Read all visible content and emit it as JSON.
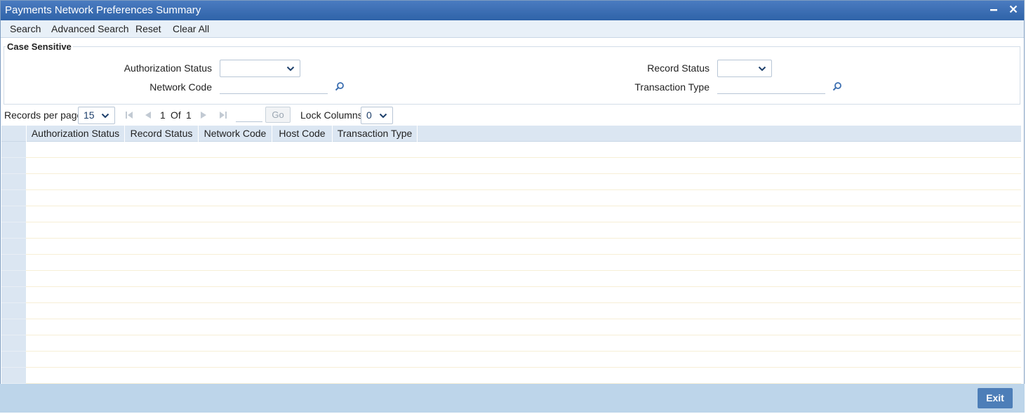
{
  "window": {
    "title": "Payments Network Preferences Summary",
    "minimize": "−",
    "close": "✕"
  },
  "toolbar": {
    "search": "Search",
    "advanced_search": "Advanced Search",
    "reset": "Reset",
    "clear_all": "Clear All"
  },
  "criteria": {
    "legend": "Case Sensitive",
    "authorization_status_label": "Authorization Status",
    "record_status_label": "Record Status",
    "network_code_label": "Network Code",
    "transaction_type_label": "Transaction Type",
    "authorization_status_value": "",
    "record_status_value": "",
    "network_code_value": "",
    "transaction_type_value": ""
  },
  "pager": {
    "records_per_page_label": "Records per page",
    "records_per_page_value": "15",
    "current_page": "1",
    "of_label": "Of",
    "total_pages": "1",
    "go_label": "Go",
    "lock_columns_label": "Lock Columns",
    "lock_columns_value": "0"
  },
  "grid": {
    "columns": [
      "Authorization Status",
      "Record Status",
      "Network Code",
      "Host Code",
      "Transaction Type"
    ],
    "row_count": 15
  },
  "footer": {
    "exit_label": "Exit"
  },
  "colors": {
    "title_bar": "#2f63a8",
    "header_bg": "#dbe6f2",
    "footer_bg": "#bdd5ea",
    "exit_button": "#4d7eb8"
  },
  "icons": {
    "lookup": "magnifier-icon",
    "chevron": "chevron-down-icon"
  }
}
